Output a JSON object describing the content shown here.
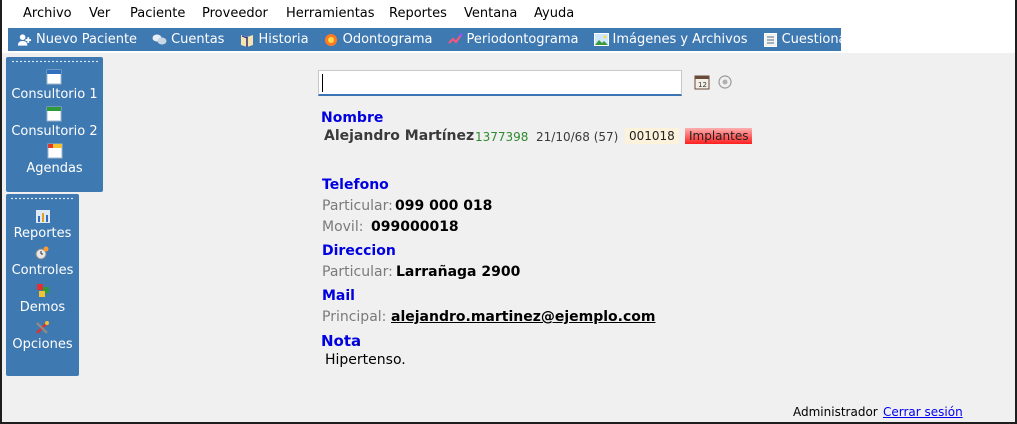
{
  "menu": [
    "Archivo",
    "Ver",
    "Paciente",
    "Proveedor",
    "Herramientas",
    "Reportes",
    "Ventana",
    "Ayuda"
  ],
  "toolbar": {
    "nuevo_paciente": "Nuevo Paciente",
    "cuentas": "Cuentas",
    "historia": "Historia",
    "odontograma": "Odontograma",
    "periodontograma": "Periodontograma",
    "imagenes": "Imágenes  y Archivos",
    "cuestionario": "Cuestionario"
  },
  "sidebar": {
    "top": [
      "Consultorio 1",
      "Consultorio 2",
      "Agendas"
    ],
    "bottom": [
      "Reportes",
      "Controles",
      "Demos",
      "Opciones"
    ]
  },
  "search": {
    "value": ""
  },
  "patient": {
    "nombre_label": "Nombre",
    "name": "Alejandro Martínez",
    "id": "1377398",
    "dob": "21/10/68 (57)",
    "code": "001018",
    "tag": "Implantes",
    "telefono_label": "Telefono",
    "particular_label": "Particular:",
    "particular_phone": "099 000 018",
    "movil_label": "Movil:",
    "movil_phone": "099000018",
    "direccion_label": "Direccion",
    "direccion_particular_label": "Particular:",
    "direccion": "Larrañaga 2900",
    "mail_label": "Mail",
    "principal_label": "Principal:",
    "email": "alejandro.martinez@ejemplo.com",
    "nota_label": "Nota",
    "nota_dot": ".",
    "nota": "Hipertenso."
  },
  "footer": {
    "user": "Administrador",
    "logout": "Cerrar sesión"
  },
  "colors": {
    "toolbar": "#3f79b2",
    "heading": "#0000e0",
    "id_green": "#2f8a2f",
    "tag_red": "#ff3030"
  }
}
